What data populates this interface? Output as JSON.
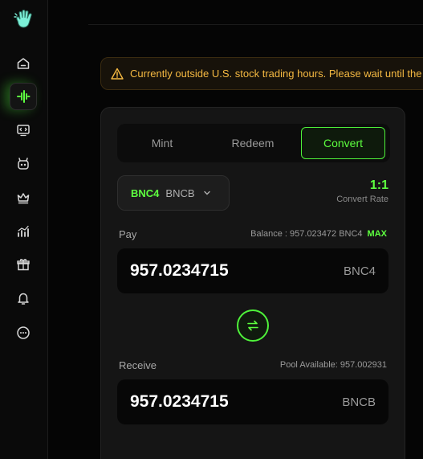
{
  "sidebar": {
    "logo_icon": "hand-wave-icon",
    "items": [
      {
        "name": "home",
        "icon": "home-icon"
      },
      {
        "name": "convert",
        "icon": "pulse-icon",
        "active": true
      },
      {
        "name": "screen",
        "icon": "monitor-code-icon"
      },
      {
        "name": "robot",
        "icon": "robot-icon"
      },
      {
        "name": "crown",
        "icon": "crown-icon"
      },
      {
        "name": "chart",
        "icon": "chart-icon"
      },
      {
        "name": "gift",
        "icon": "gift-icon"
      },
      {
        "name": "bell",
        "icon": "bell-icon"
      },
      {
        "name": "more",
        "icon": "more-icon"
      }
    ]
  },
  "banner": {
    "text": "Currently outside U.S. stock trading hours. Please wait until the"
  },
  "tabs": [
    {
      "label": "Mint"
    },
    {
      "label": "Redeem"
    },
    {
      "label": "Convert",
      "active": true
    }
  ],
  "pair": {
    "from": "BNC4",
    "to": "BNCB"
  },
  "rate": {
    "value": "1:1",
    "label": "Convert Rate"
  },
  "pay": {
    "label": "Pay",
    "balance_text": "Balance : 957.023472 BNC4",
    "max_label": "MAX",
    "amount": "957.0234715",
    "token": "BNC4"
  },
  "receive": {
    "label": "Receive",
    "pool_text": "Pool Available: 957.002931",
    "amount": "957.0234715",
    "token": "BNCB"
  },
  "colors": {
    "accent": "#5dff3f",
    "warning": "#f5b942",
    "background": "#050505",
    "card": "#151515"
  }
}
